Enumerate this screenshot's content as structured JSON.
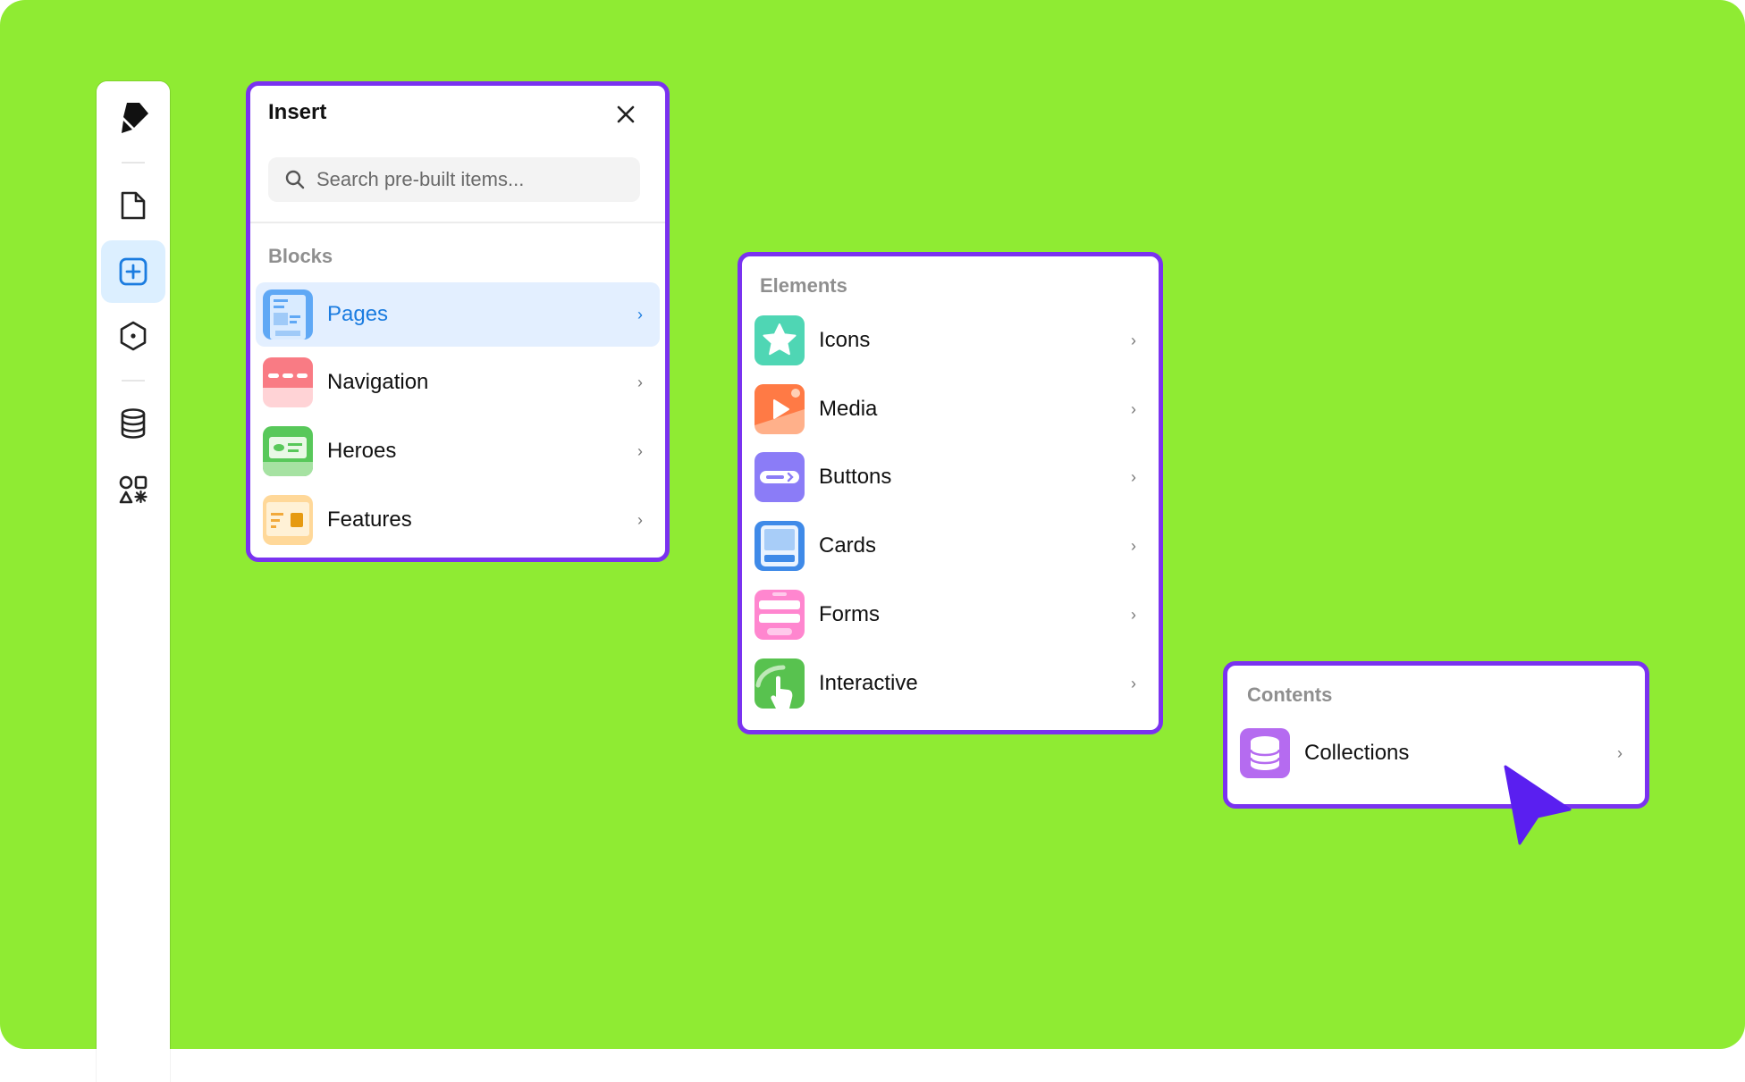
{
  "colors": {
    "background": "#8feb33",
    "panel_border": "#7a32f0",
    "active_bg": "#e3efff",
    "active_text": "#1b7ce0",
    "cursor": "#5a1ff0"
  },
  "sidebar": {
    "items": [
      {
        "icon": "logo-icon"
      },
      {
        "icon": "page-icon"
      },
      {
        "icon": "plus-square-icon",
        "active": true
      },
      {
        "icon": "hexagon-icon"
      },
      {
        "icon": "database-icon"
      },
      {
        "icon": "components-icon"
      }
    ]
  },
  "insert_panel": {
    "title": "Insert",
    "search_placeholder": "Search pre-built items...",
    "section": "Blocks",
    "items": [
      {
        "label": "Pages",
        "icon": "pages-icon",
        "active": true
      },
      {
        "label": "Navigation",
        "icon": "navigation-icon"
      },
      {
        "label": "Heroes",
        "icon": "heroes-icon"
      },
      {
        "label": "Features",
        "icon": "features-icon"
      }
    ]
  },
  "elements_panel": {
    "section": "Elements",
    "items": [
      {
        "label": "Icons",
        "icon": "star-icon"
      },
      {
        "label": "Media",
        "icon": "media-icon"
      },
      {
        "label": "Buttons",
        "icon": "buttons-icon"
      },
      {
        "label": "Cards",
        "icon": "cards-icon"
      },
      {
        "label": "Forms",
        "icon": "forms-icon"
      },
      {
        "label": "Interactive",
        "icon": "interactive-icon"
      }
    ]
  },
  "contents_panel": {
    "section": "Contents",
    "items": [
      {
        "label": "Collections",
        "icon": "collections-icon"
      }
    ]
  }
}
